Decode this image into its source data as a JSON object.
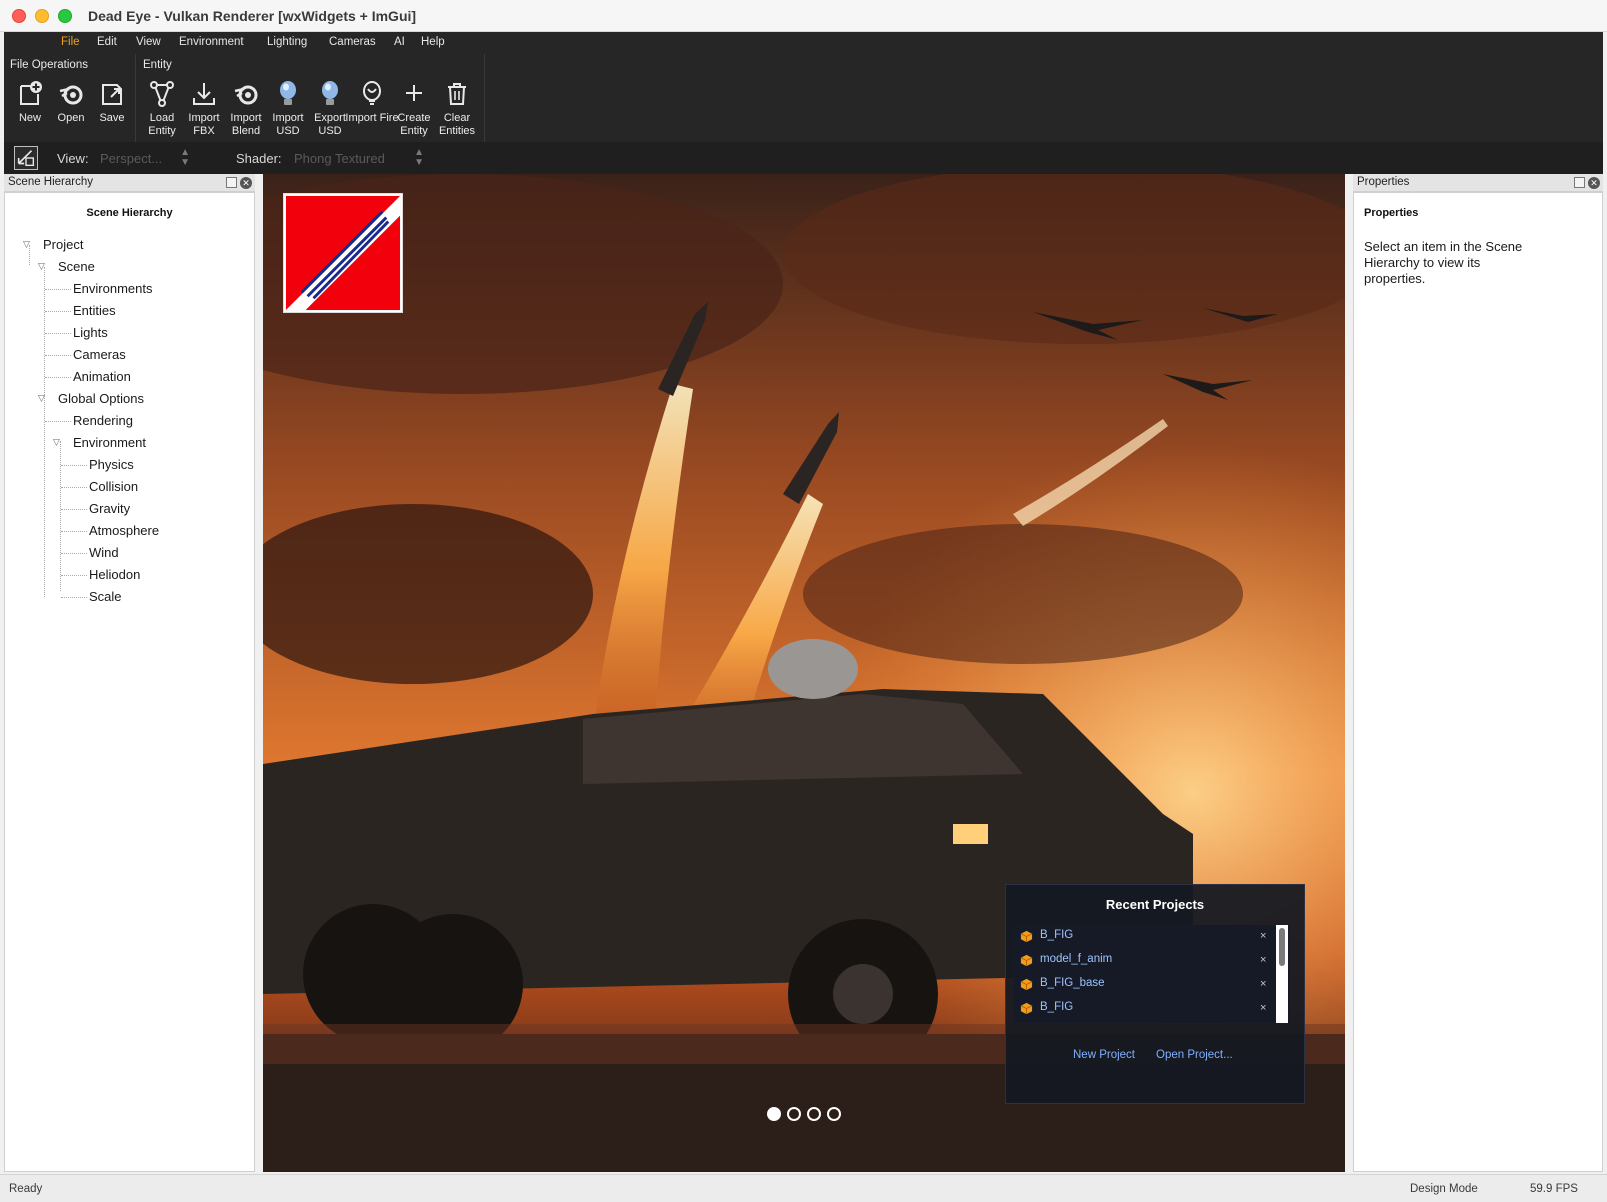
{
  "window": {
    "title": "Dead Eye - Vulkan Renderer [wxWidgets + ImGui]"
  },
  "menubar": [
    {
      "label": "File",
      "active": true
    },
    {
      "label": "Edit"
    },
    {
      "label": "View"
    },
    {
      "label": "Environment"
    },
    {
      "label": "Lighting"
    },
    {
      "label": "Cameras"
    },
    {
      "label": "AI"
    },
    {
      "label": "Help"
    }
  ],
  "ribbon": {
    "file_group": {
      "title": "File Operations",
      "tools": [
        {
          "label": "New",
          "icon": "new-document-icon"
        },
        {
          "label": "Open",
          "icon": "blender-open-icon"
        },
        {
          "label": "Save",
          "icon": "save-icon"
        }
      ]
    },
    "entity_group": {
      "title": "Entity",
      "tools": [
        {
          "label": "Load Entity",
          "icon": "node-graph-icon"
        },
        {
          "label": "Import FBX",
          "icon": "download-icon"
        },
        {
          "label": "Import Blend",
          "icon": "blender-icon"
        },
        {
          "label": "Import USD",
          "icon": "lightbulb-icon"
        },
        {
          "label": "Export USD",
          "icon": "lightbulb-icon"
        },
        {
          "label": "Import Fire",
          "icon": "fire-bulb-icon"
        },
        {
          "label": "Create Entity",
          "icon": "plus-icon"
        },
        {
          "label": "Clear Entities",
          "icon": "trash-icon"
        }
      ]
    }
  },
  "viewbar": {
    "view_label": "View:",
    "view_value": "Perspect...",
    "shader_label": "Shader:",
    "shader_value": "Phong Textured"
  },
  "scene_hierarchy": {
    "header": "Scene Hierarchy",
    "title": "Scene Hierarchy",
    "items": [
      {
        "label": "Project",
        "level": 0,
        "expandable": true
      },
      {
        "label": "Scene",
        "level": 1,
        "expandable": true
      },
      {
        "label": "Environments",
        "level": 2
      },
      {
        "label": "Entities",
        "level": 2
      },
      {
        "label": "Lights",
        "level": 2
      },
      {
        "label": "Cameras",
        "level": 2
      },
      {
        "label": "Animation",
        "level": 2
      },
      {
        "label": "Global Options",
        "level": 1,
        "expandable": true
      },
      {
        "label": "Rendering",
        "level": 2
      },
      {
        "label": "Environment",
        "level": 2,
        "expandable": true
      },
      {
        "label": "Physics",
        "level": 3
      },
      {
        "label": "Collision",
        "level": 3
      },
      {
        "label": "Gravity",
        "level": 3
      },
      {
        "label": "Atmosphere",
        "level": 3
      },
      {
        "label": "Wind",
        "level": 3
      },
      {
        "label": "Heliodon",
        "level": 3
      },
      {
        "label": "Scale",
        "level": 3
      }
    ]
  },
  "properties": {
    "header": "Properties",
    "title": "Properties",
    "message": "Select an item in the Scene Hierarchy to view its properties."
  },
  "recent_projects": {
    "title": "Recent Projects",
    "items": [
      {
        "name": "B_FIG"
      },
      {
        "name": "model_f_anim"
      },
      {
        "name": "B_FIG_base"
      },
      {
        "name": "B_FIG"
      }
    ],
    "new_project": "New Project",
    "open_project": "Open Project...",
    "close_glyph": "×"
  },
  "carousel": {
    "count": 4,
    "active": 0
  },
  "status": {
    "left": "Ready",
    "mode": "Design Mode",
    "fps": "59.9 FPS"
  },
  "colors": {
    "menu_active": "#f0a020",
    "toolbar_bg": "#262626",
    "link": "#7fb0ff",
    "project_icon": "#f39c1b"
  }
}
